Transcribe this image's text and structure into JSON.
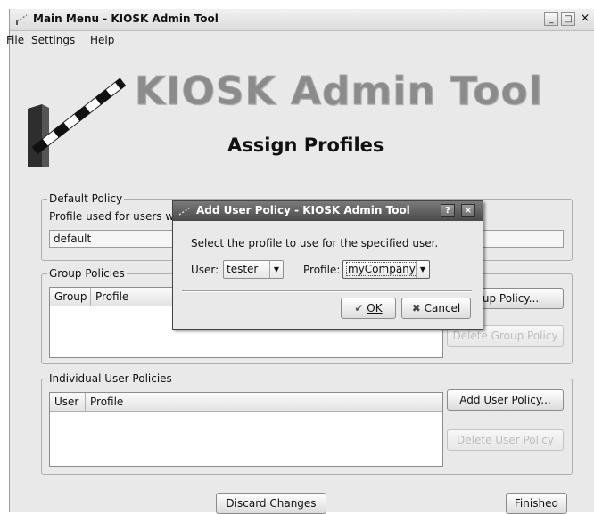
{
  "window": {
    "title": "Main Menu - KIOSK Admin Tool",
    "minimize": "_",
    "maximize": "□",
    "close": "×"
  },
  "menu": {
    "file": "File",
    "settings": "Settings",
    "help": "Help"
  },
  "header": {
    "app_name": "KIOSK Admin Tool",
    "page_title": "Assign Profiles"
  },
  "default_policy": {
    "title": "Default Policy",
    "description": "Profile used for users wit",
    "value": "default"
  },
  "group_policies": {
    "title": "Group Policies",
    "columns": [
      "Group",
      "Profile"
    ],
    "rows": [],
    "add_button": "roup Policy...",
    "delete_button": "Delete Group Policy"
  },
  "user_policies": {
    "title": "Individual User Policies",
    "columns": [
      "User",
      "Profile"
    ],
    "rows": [],
    "add_button": "Add User Policy...",
    "delete_button": "Delete User Policy"
  },
  "footer": {
    "discard": "Discard Changes",
    "finished": "Finished"
  },
  "dialog": {
    "title": "Add User Policy - KIOSK Admin Tool",
    "help": "?",
    "close": "×",
    "prompt": "Select the profile to use for the specified user.",
    "user_label": "User:",
    "user_value": "tester",
    "profile_label": "Profile:",
    "profile_value": "myCompany",
    "ok": "OK",
    "cancel": "Cancel"
  },
  "colors": {
    "window_bg": "#e9e9e9",
    "dialog_title_bg": "#5a5a5a",
    "logo_text": "#8b8b8b"
  }
}
